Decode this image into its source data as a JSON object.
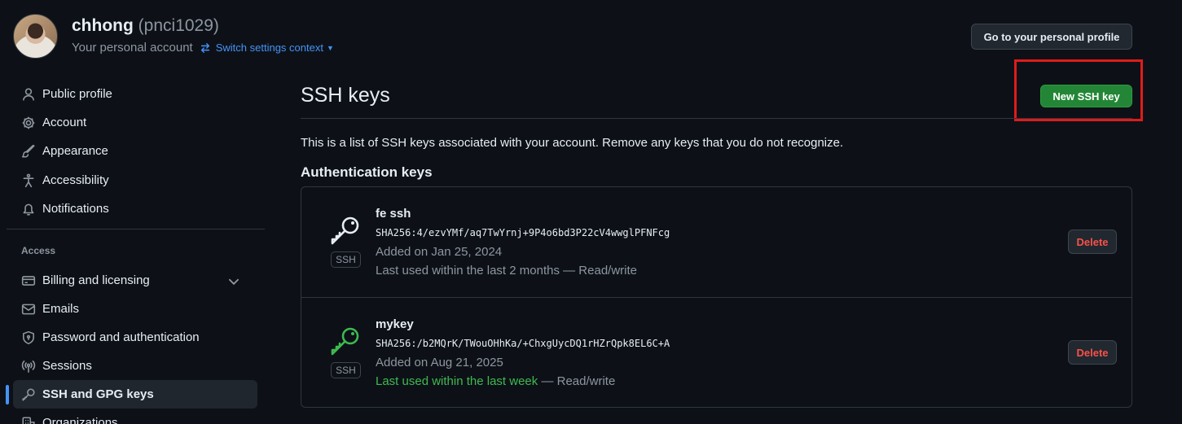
{
  "header": {
    "user_name": "chhong",
    "user_login": "(pnci1029)",
    "account_label": "Your personal account",
    "switch_context_label": "Switch settings context",
    "profile_button_label": "Go to your personal profile"
  },
  "sidebar": {
    "items_top": [
      {
        "label": "Public profile",
        "icon": "person-icon"
      },
      {
        "label": "Account",
        "icon": "gear-icon"
      },
      {
        "label": "Appearance",
        "icon": "paintbrush-icon"
      },
      {
        "label": "Accessibility",
        "icon": "accessibility-icon"
      },
      {
        "label": "Notifications",
        "icon": "bell-icon"
      }
    ],
    "access_section_label": "Access",
    "items_access": [
      {
        "label": "Billing and licensing",
        "icon": "credit-card-icon"
      },
      {
        "label": "Emails",
        "icon": "mail-icon"
      },
      {
        "label": "Password and authentication",
        "icon": "shield-lock-icon"
      },
      {
        "label": "Sessions",
        "icon": "broadcast-icon"
      },
      {
        "label": "SSH and GPG keys",
        "icon": "key-icon",
        "active": true
      },
      {
        "label": "Organizations",
        "icon": "organization-icon"
      }
    ]
  },
  "main": {
    "title": "SSH keys",
    "new_key_button_label": "New SSH key",
    "intro": "This is a list of SSH keys associated with your account. Remove any keys that you do not recognize.",
    "section_title": "Authentication keys",
    "keys": [
      {
        "name": "fe ssh",
        "fingerprint": "SHA256:4/ezvYMf/aq7TwYrnj+9P4o6bd3P22cV4wwglPFNFcg",
        "added": "Added on Jan 25, 2024",
        "last_used": "Last used within the last 2 months",
        "access": " — Read/write",
        "badge": "SSH",
        "delete_label": "Delete",
        "icon_color": "#e6edf3"
      },
      {
        "name": "mykey",
        "fingerprint": "SHA256:/b2MQrK/TWouOHhKa/+ChxgUycDQ1rHZrQpk8EL6C+A",
        "added": "Added on Aug 21, 2025",
        "last_used": "Last used within the last week",
        "access": " — Read/write",
        "badge": "SSH",
        "delete_label": "Delete",
        "icon_color": "#3fb950"
      }
    ]
  },
  "colors": {
    "background": "#0d1117",
    "accent_blue": "#4493f8",
    "primary_green": "#238636",
    "danger_red": "#f85149",
    "highlight_red": "#e01b1b"
  }
}
